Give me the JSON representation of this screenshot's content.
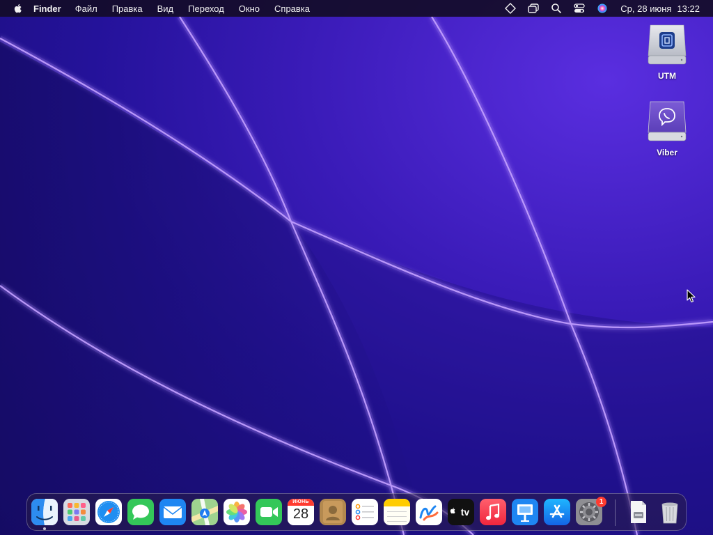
{
  "menubar": {
    "app_name": "Finder",
    "items": [
      "Файл",
      "Правка",
      "Вид",
      "Переход",
      "Окно",
      "Справка"
    ],
    "status_icons": [
      "sparkle-diamond-icon",
      "window-stack-icon",
      "search-icon",
      "control-center-icon",
      "siri-icon"
    ],
    "clock": {
      "date": "Ср, 28 июня",
      "time": "13:22"
    }
  },
  "desktop": {
    "icons": [
      {
        "label": "UTM",
        "icon": "utm-disk-icon"
      },
      {
        "label": "Viber",
        "icon": "viber-disk-icon"
      }
    ]
  },
  "dock": {
    "apps": [
      {
        "name": "finder",
        "icon": "finder-icon",
        "running": true
      },
      {
        "name": "launchpad",
        "icon": "launchpad-icon"
      },
      {
        "name": "safari",
        "icon": "safari-icon"
      },
      {
        "name": "messages",
        "icon": "messages-icon"
      },
      {
        "name": "mail",
        "icon": "mail-icon"
      },
      {
        "name": "maps",
        "icon": "maps-icon"
      },
      {
        "name": "photos",
        "icon": "photos-icon"
      },
      {
        "name": "facetime",
        "icon": "facetime-icon"
      },
      {
        "name": "calendar",
        "icon": "calendar-icon"
      },
      {
        "name": "contacts",
        "icon": "contacts-icon"
      },
      {
        "name": "reminders",
        "icon": "reminders-icon"
      },
      {
        "name": "notes",
        "icon": "notes-icon"
      },
      {
        "name": "freeform",
        "icon": "freeform-icon"
      },
      {
        "name": "tv",
        "icon": "apple-tv-icon"
      },
      {
        "name": "music",
        "icon": "music-icon"
      },
      {
        "name": "keynote",
        "icon": "keynote-icon"
      },
      {
        "name": "app-store",
        "icon": "app-store-icon"
      },
      {
        "name": "system-settings",
        "icon": "settings-gear-icon"
      },
      {
        "name": "downloads-stack",
        "icon": "downloads-stack-icon"
      },
      {
        "name": "trash",
        "icon": "trash-icon"
      }
    ],
    "calendar": {
      "month": "ИЮНЬ",
      "day": "28"
    },
    "tv_label": "tv",
    "settings_badge": "1"
  },
  "colors": {
    "wallpaper_deep": "#170c6a",
    "wallpaper_bright": "#5a2ee0",
    "wallpaper_glow": "#c9a6ff",
    "badge": "#ff3b30"
  }
}
